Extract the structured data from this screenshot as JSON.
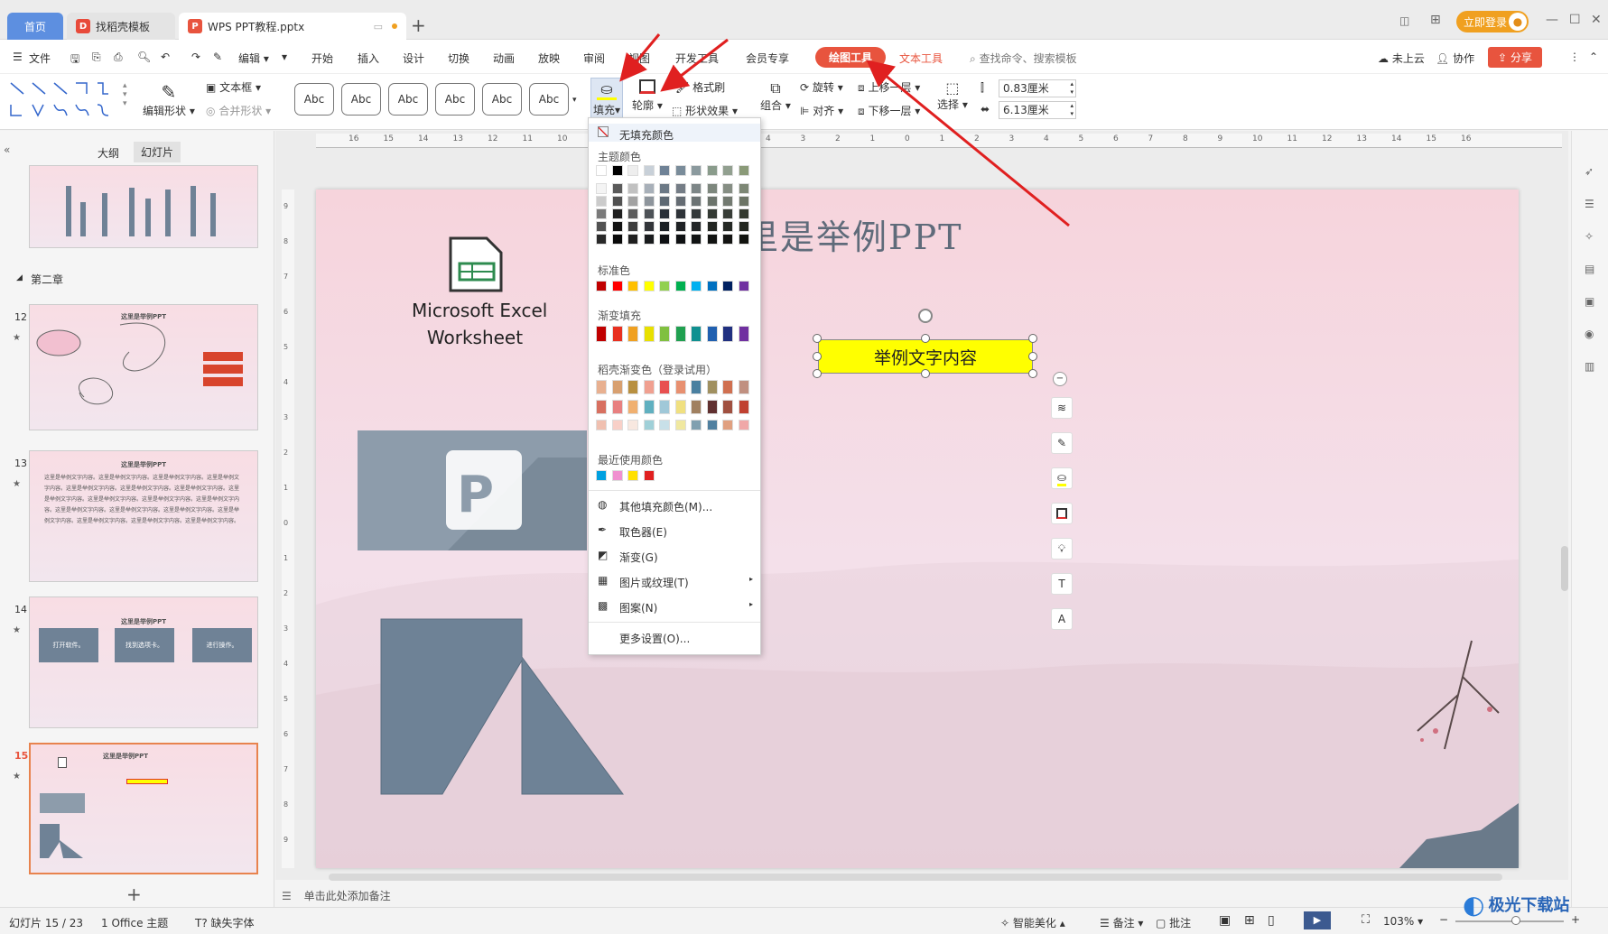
{
  "tabs": {
    "home": "首页",
    "docer": "找稻壳模板",
    "doc": "WPS PPT教程.pptx"
  },
  "login": "立即登录",
  "menu": {
    "file": "文件",
    "edit": "编辑",
    "items": [
      "开始",
      "插入",
      "设计",
      "切换",
      "动画",
      "放映",
      "审阅",
      "视图",
      "开发工具",
      "会员专享"
    ],
    "drawtool": "绘图工具",
    "texttool": "文本工具",
    "search": "查找命令、搜索模板",
    "cloud": "未上云",
    "collab": "协作",
    "share": "分享"
  },
  "ribbon": {
    "edit_shape": "编辑形状",
    "textbox": "文本框",
    "merge_shape": "合并形状",
    "abc": [
      "Abc",
      "Abc",
      "Abc",
      "Abc",
      "Abc",
      "Abc"
    ],
    "fill": "填充",
    "outline": "轮廓",
    "format_brush": "格式刷",
    "shape_effect": "形状效果",
    "rotate": "旋转",
    "group": "组合",
    "align": "对齐",
    "bring_forward": "上移一层",
    "send_backward": "下移一层",
    "select": "选择",
    "height": "0.83厘米",
    "width": "6.13厘米"
  },
  "panel": {
    "outline_tab": "大纲",
    "slides_tab": "幻灯片",
    "chapter": "第二章",
    "slide_nums": [
      "12",
      "13",
      "14",
      "15"
    ],
    "thumb12_title": "这里是举例PPT",
    "thumb13_title": "这里是举例PPT",
    "thumb13_text": "这里是举例文字内容。这里是举例文字内容。这里是举例文字内容。这里是举例文字内容。这里是举例文字内容。这里是举例文字内容。这里是举例文字内容。这里是举例文字内容。这里是举例文字内容。这里是举例文字内容。这里是举例文字内容。这里是举例文字内容。这里是举例文字内容。这里是举例文字内容。这里是举例文字内容。这里是举例文字内容。这里是举例文字内容。这里是举例文字内容。",
    "thumb14_title": "这里是举例PPT",
    "thumb14_boxes": [
      "打开软件。",
      "找到选项卡。",
      "进行操作。"
    ],
    "thumb15_title": "这里是举例PPT"
  },
  "slide": {
    "title": "里是举例PPT",
    "excel_label_1": "Microsoft Excel",
    "excel_label_2": "Worksheet",
    "textbox": "举例文字内容"
  },
  "notes": "单击此处添加备注",
  "status": {
    "slide_count": "幻灯片 15 / 23",
    "theme": "1 Office 主题",
    "missing_font": "缺失字体",
    "beautify": "智能美化",
    "remarks": "备注",
    "comment": "批注",
    "zoom": "103%"
  },
  "fill_menu": {
    "no_fill": "无填充颜色",
    "theme_colors": "主题颜色",
    "standard_colors": "标准色",
    "gradient_fill": "渐变填充",
    "docer_gradient": "稻壳渐变色（登录试用）",
    "recent_colors": "最近使用颜色",
    "more_colors": "其他填充颜色(M)...",
    "eyedropper": "取色器(E)",
    "gradient": "渐变(G)",
    "picture_texture": "图片或纹理(T)",
    "pattern": "图案(N)",
    "more_settings": "更多设置(O)..."
  },
  "colors": {
    "theme_row": [
      "#ffffff",
      "#000000",
      "#eeeeee",
      "#c8d0d8",
      "#6f8296",
      "#7a8c9a",
      "#8b9a9e",
      "#8a9c8c",
      "#92a090",
      "#8a9a78"
    ],
    "standard": [
      "#c00000",
      "#ff0000",
      "#ffc000",
      "#ffff00",
      "#92d050",
      "#00b050",
      "#00b0f0",
      "#0070c0",
      "#002060",
      "#7030a0"
    ],
    "gradient": [
      "#c00000",
      "#e83020",
      "#f0a020",
      "#e8e000",
      "#80c040",
      "#20a050",
      "#109090",
      "#2060b0",
      "#203080",
      "#7030a0"
    ],
    "docer_row1": [
      "#e8b090",
      "#d8a070",
      "#b89040",
      "#f0a090",
      "#e85050",
      "#e89070",
      "#4a80a0",
      "#a09060",
      "#d07050",
      "#c09080"
    ],
    "docer_row2": [
      "#d87060",
      "#e88080",
      "#f0b070",
      "#60b0c0",
      "#a0c8d8",
      "#f0e080",
      "#a08060",
      "#603030",
      "#a05040",
      "#c04030"
    ],
    "docer_row3": [
      "#f0c0b0",
      "#f8d0c8",
      "#f8e8e0",
      "#a0d0d8",
      "#c8e0e8",
      "#f0e8a0",
      "#80a0b0",
      "#5080a0",
      "#e0a080",
      "#f0a8a8"
    ],
    "recent": [
      "#00a0e0",
      "#f090d0",
      "#ffe000",
      "#e02020"
    ],
    "accent": "#e8543e",
    "shape": "#6e8296",
    "highlight": "#ffff00"
  },
  "rulers": {
    "h": [
      "16",
      "15",
      "14",
      "13",
      "12",
      "11",
      "10",
      "9",
      "8",
      "7",
      "6",
      "5",
      "4",
      "3",
      "2",
      "1",
      "0",
      "1",
      "2",
      "3",
      "4",
      "5",
      "6",
      "7",
      "8",
      "9",
      "10",
      "11",
      "12",
      "13",
      "14",
      "15",
      "16"
    ],
    "v": [
      "9",
      "8",
      "7",
      "6",
      "5",
      "4",
      "3",
      "2",
      "1",
      "0",
      "1",
      "2",
      "3",
      "4",
      "5",
      "6",
      "7",
      "8",
      "9"
    ]
  },
  "watermark": "极光下载站"
}
